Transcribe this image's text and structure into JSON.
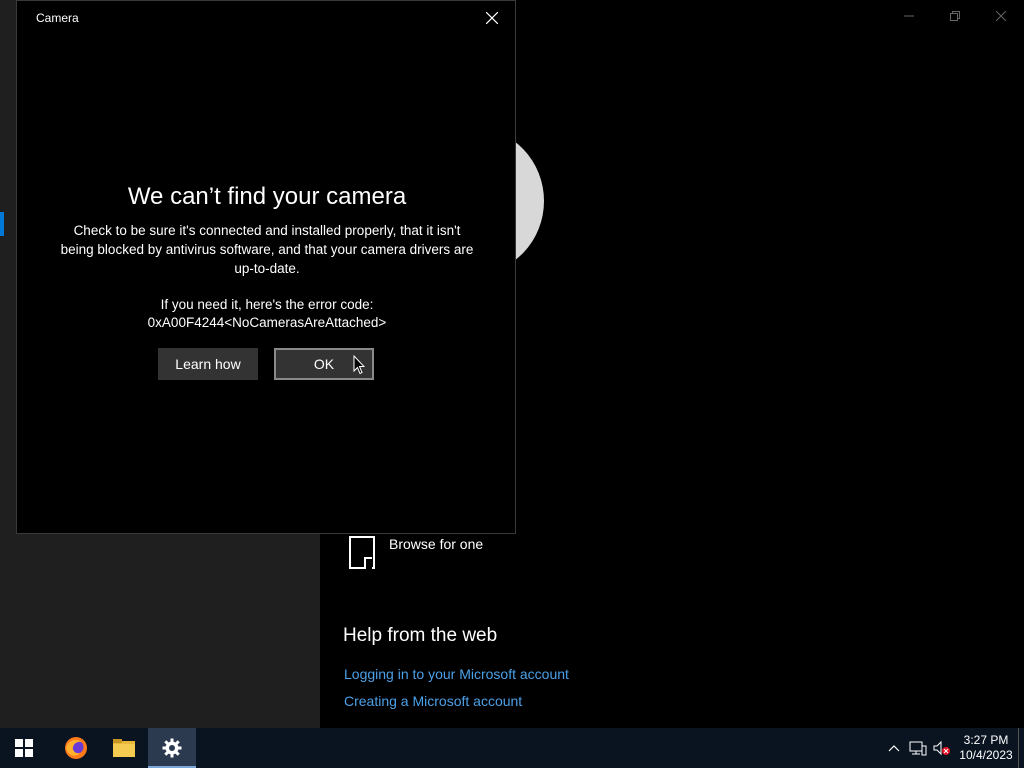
{
  "background": {
    "browse_label": "Browse for one",
    "help_title": "Help from the web",
    "help_links": [
      "Logging in to your Microsoft account",
      "Creating a Microsoft account"
    ]
  },
  "dialog": {
    "title": "Camera",
    "heading": "We can’t find your camera",
    "body": "Check to be sure it's connected and installed properly, that it isn't being blocked by antivirus software, and that your camera drivers are up-to-date.",
    "error_intro": "If you need it, here's the error code:",
    "error_code": "0xA00F4244<NoCamerasAreAttached>",
    "learn_label": "Learn how",
    "ok_label": "OK"
  },
  "taskbar": {
    "items": [
      "start-icon",
      "firefox-icon",
      "file-explorer-icon",
      "settings-icon"
    ],
    "active": "settings-icon",
    "time": "3:27 PM",
    "date": "10/4/2023"
  },
  "colors": {
    "link": "#4ba0e8",
    "accent": "#0078d7",
    "taskbar": "#0a1420"
  }
}
